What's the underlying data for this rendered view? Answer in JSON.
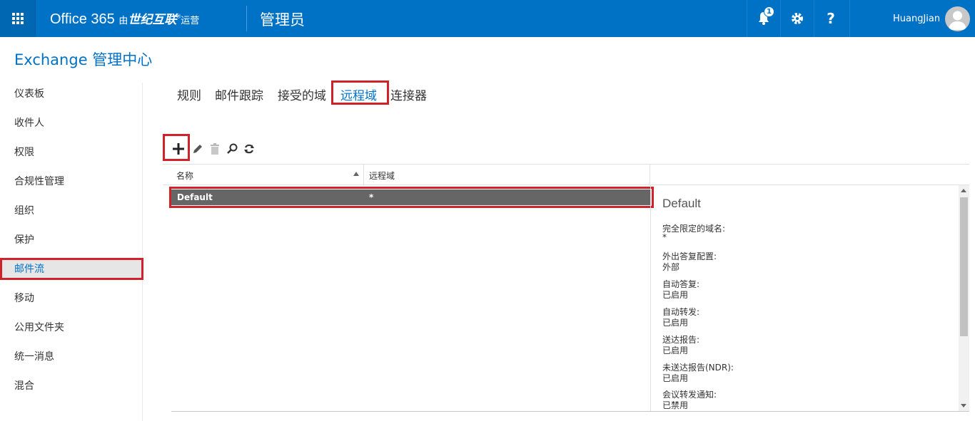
{
  "topbar": {
    "brand_main": "Office 365 ",
    "brand_you": "由",
    "brand_company": "世纪互联",
    "brand_reg": "®",
    "brand_operate": "运营",
    "admin_title": "管理员",
    "notification_count": "1",
    "help_label": "?",
    "user_name": "HuangJian"
  },
  "app_title": "Exchange 管理中心",
  "nav": {
    "items": [
      {
        "label": "仪表板"
      },
      {
        "label": "收件人"
      },
      {
        "label": "权限"
      },
      {
        "label": "合规性管理"
      },
      {
        "label": "组织"
      },
      {
        "label": "保护"
      },
      {
        "label": "邮件流"
      },
      {
        "label": "移动"
      },
      {
        "label": "公用文件夹"
      },
      {
        "label": "统一消息"
      },
      {
        "label": "混合"
      }
    ],
    "active": "邮件流"
  },
  "tabs": [
    {
      "label": "规则"
    },
    {
      "label": "邮件跟踪"
    },
    {
      "label": "接受的域"
    },
    {
      "label": "远程域"
    },
    {
      "label": "连接器"
    }
  ],
  "toolbar": {
    "icons": [
      "add-icon",
      "edit-icon",
      "delete-icon",
      "search-icon",
      "refresh-icon"
    ]
  },
  "grid": {
    "columns": [
      {
        "label": "名称"
      },
      {
        "label": "远程域"
      }
    ],
    "rows": [
      {
        "name": "Default",
        "domain": "*"
      }
    ]
  },
  "details": {
    "title": "Default",
    "fields": [
      {
        "label": "完全限定的域名:",
        "value": "*"
      },
      {
        "label": "外出答复配置:",
        "value": "外部"
      },
      {
        "label": "自动答复:",
        "value": "已启用"
      },
      {
        "label": "自动转发:",
        "value": "已启用"
      },
      {
        "label": "送达报告:",
        "value": "已启用"
      },
      {
        "label": "未送达报告(NDR):",
        "value": "已启用"
      },
      {
        "label": "会议转发通知:",
        "value": "已禁用"
      }
    ]
  },
  "colors": {
    "topbar": "#0072c6",
    "highlight": "#d0222b",
    "selected_row": "#666666"
  }
}
